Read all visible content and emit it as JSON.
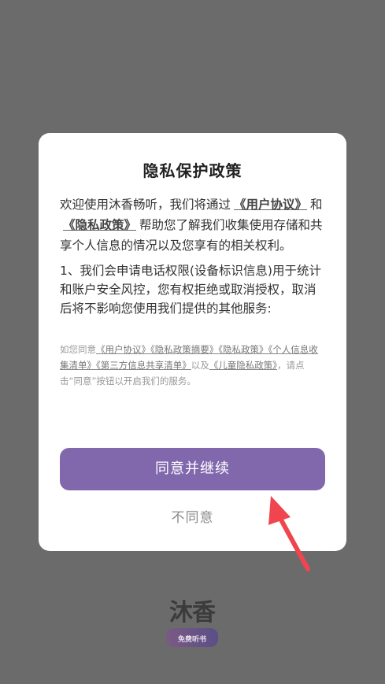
{
  "dialog": {
    "title": "隐私保护政策",
    "intro": {
      "p1": "欢迎使用沐香畅听，我们将通过",
      "link_user_agreement": "《用户协议》",
      "p2": "和",
      "link_privacy_policy": "《隐私政策》",
      "p3": "帮助您了解我们收集使用存储和共享个人信息的情况以及您享有的相关权利。"
    },
    "point1": "1、我们会申请电话权限(设备标识信息)用于统计和账户安全风控，您有权拒绝或取消授权，取消后将不影响您使用我们提供的其他服务:",
    "fine": {
      "prefix": "如您同意",
      "link_user_agreement": "《用户协议》",
      "link_privacy_summary": "《隐私政策摘要》",
      "link_privacy_policy": "《隐私政策》",
      "link_info_collection": "《个人信息收集清单》",
      "link_third_party": "《第三方信息共享清单》",
      "and": "以及",
      "link_children_privacy": "《儿童隐私政策》",
      "suffix": "，请点击“同意”按钮以开启我们的服务。"
    },
    "agree_button": "同意并继续",
    "disagree_button": "不同意"
  },
  "splash": {
    "logo_text": "沐香",
    "logo_badge": "免费听书"
  },
  "colors": {
    "overlay": "#6b6b6b",
    "accent": "#8168ad",
    "arrow": "#f0454f"
  },
  "icons": [
    "pointer-arrow-icon",
    "app-logo"
  ]
}
